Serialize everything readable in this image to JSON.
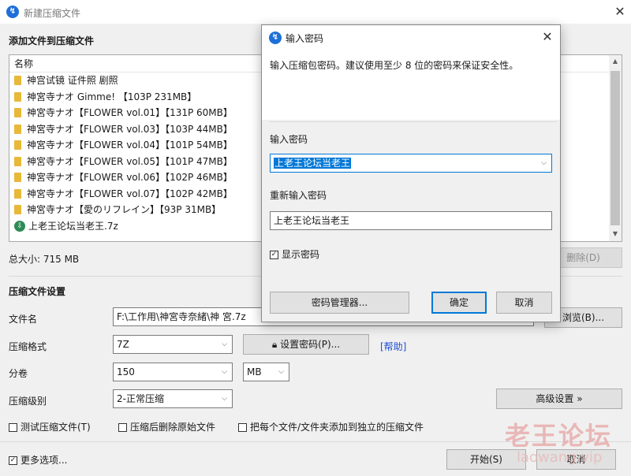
{
  "window": {
    "title": "新建压缩文件",
    "close_label": "✕"
  },
  "files_section": {
    "heading": "添加文件到压缩文件",
    "column_name": "名称",
    "items": [
      {
        "type": "folder",
        "name": "神宫试镜 证件照 剧照"
      },
      {
        "type": "folder",
        "name": "神宮寺ナオ Gimme! 【103P 231MB】"
      },
      {
        "type": "folder",
        "name": "神宮寺ナオ【FLOWER vol.01】【131P 60MB】"
      },
      {
        "type": "folder",
        "name": "神宮寺ナオ【FLOWER vol.03】【103P 44MB】"
      },
      {
        "type": "folder",
        "name": "神宮寺ナオ【FLOWER vol.04】【101P 54MB】"
      },
      {
        "type": "folder",
        "name": "神宮寺ナオ【FLOWER vol.05】【101P 47MB】"
      },
      {
        "type": "folder",
        "name": "神宮寺ナオ【FLOWER vol.06】【102P 46MB】"
      },
      {
        "type": "folder",
        "name": "神宮寺ナオ【FLOWER vol.07】【102P 42MB】"
      },
      {
        "type": "folder",
        "name": "神宮寺ナオ【愛のリフレイン】【93P 31MB】"
      },
      {
        "type": "archive",
        "name": "上老王论坛当老王.7z"
      }
    ],
    "total_size": "总大小: 715 MB",
    "delete_label": "删除(D)"
  },
  "settings": {
    "heading": "压缩文件设置",
    "filename_label": "文件名",
    "filename_value": "F:\\工作用\\神宮寺奈緒\\神 宮.7z",
    "browse_label": "浏览(B)...",
    "format_label": "压缩格式",
    "format_value": "7Z",
    "set_password_label": "设置密码(P)...",
    "help_label": "[帮助]",
    "volume_label": "分卷",
    "volume_value": "150",
    "volume_unit": "MB",
    "level_label": "压缩级别",
    "level_value": "2-正常压缩",
    "advanced_label": "高级设置 »",
    "test_label": "测试压缩文件(T)",
    "delete_after_label": "压缩后删除原始文件",
    "separate_label": "把每个文件/文件夹添加到独立的压缩文件",
    "more_options_label": "更多选项...",
    "start_label": "开始(S)",
    "cancel_label": "取消"
  },
  "password_dialog": {
    "title": "输入密码",
    "hint": "输入压缩包密码。建议使用至少 8 位的密码来保证安全性。",
    "password_label": "输入密码",
    "password_value": "上老王论坛当老王",
    "confirm_label": "重新输入密码",
    "confirm_value": "上老王论坛当老王",
    "show_password_label": "显示密码",
    "manager_label": "密码管理器...",
    "ok_label": "确定",
    "cancel_label": "取消"
  },
  "watermark": {
    "text": "老王论坛",
    "sub": "laowang.vip"
  },
  "icons": {
    "app": "bandizip-icon",
    "folder": "folder-icon",
    "archive": "archive-icon",
    "lock": "lock-icon"
  },
  "colors": {
    "accent": "#0078d7",
    "folder": "#e8b838",
    "link": "#1f4fd1",
    "watermark": "#e8a9a9"
  }
}
